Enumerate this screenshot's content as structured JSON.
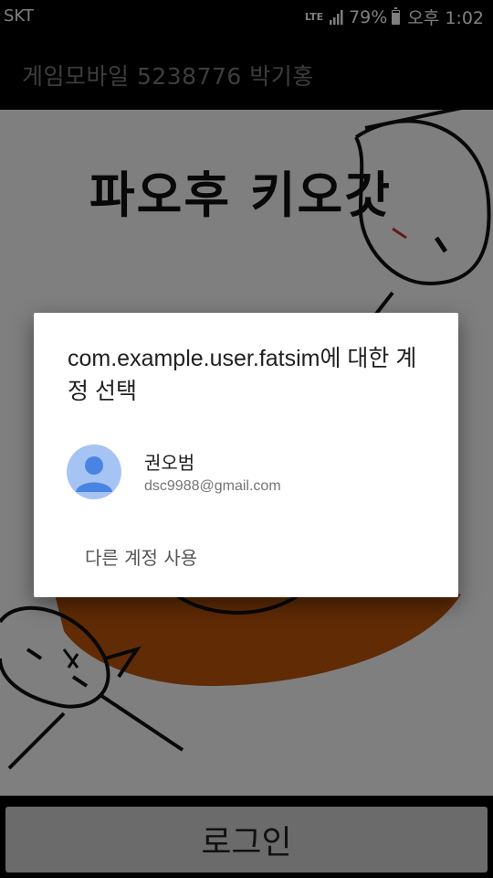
{
  "status_bar": {
    "carrier": "SKT",
    "network": "LTE",
    "battery": "79%",
    "time": "오후 1:02"
  },
  "app_bar": {
    "title": "게임모바일 5238776 박기홍"
  },
  "canvas": {
    "drawn_text": "파오후 키오갓",
    "drawing_color": "#111111",
    "accent_color": "#c0560a"
  },
  "dialog": {
    "title": "com.example.user.fatsim에 대한 계정 선택",
    "account": {
      "name": "권오범",
      "email": "dsc9988@gmail.com"
    },
    "other_account_label": "다른 계정 사용"
  },
  "bottom": {
    "login_label": "로그인"
  },
  "colors": {
    "avatar_bg": "#a6c4f3",
    "avatar_figure": "#4a84e3"
  }
}
